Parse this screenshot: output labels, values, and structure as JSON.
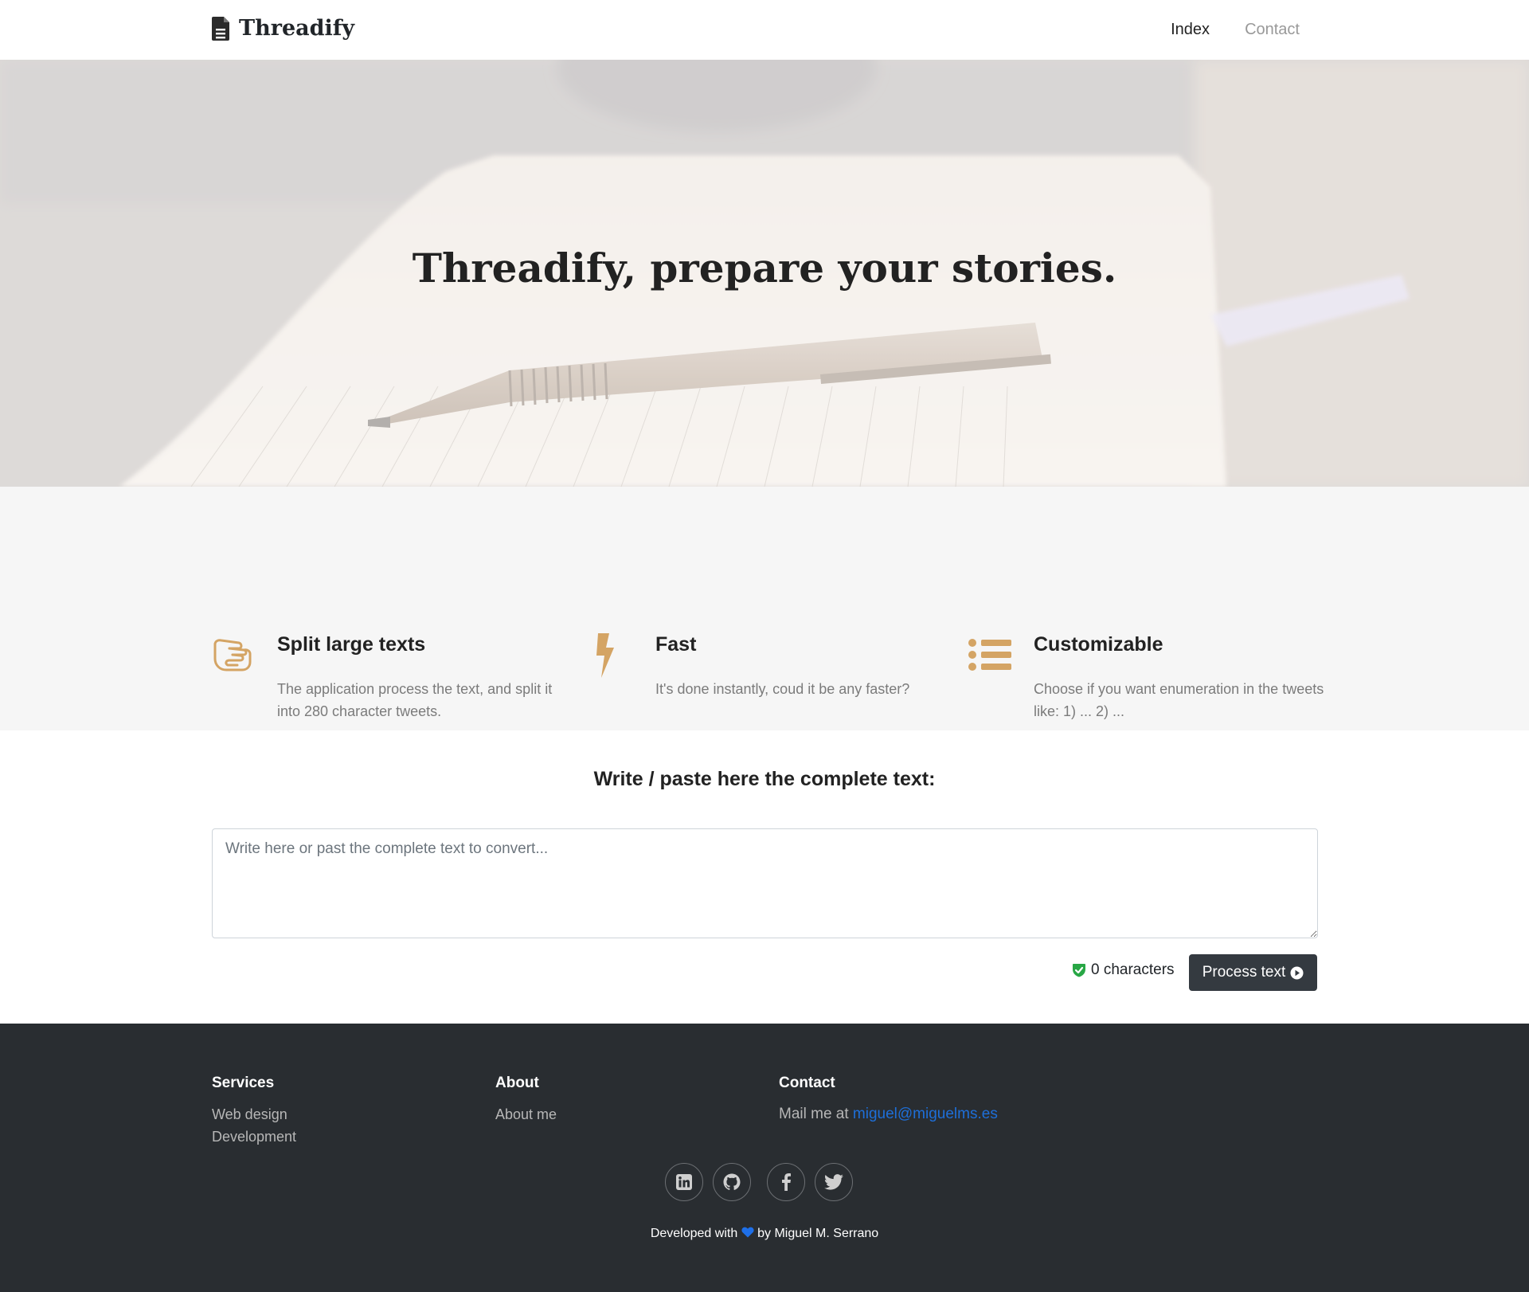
{
  "navbar": {
    "brand": "Threadify",
    "brand_icon": "file-icon",
    "links": [
      "Index",
      "Contact"
    ]
  },
  "hero": {
    "title_bold": "Threadify",
    "title_rest": ", prepare your stories."
  },
  "features": [
    {
      "icon": "hand-peace-icon",
      "title": "Split large texts",
      "text": "The application process the text, and split it into 280 character tweets."
    },
    {
      "icon": "bolt-icon",
      "title": "Fast",
      "text": "It's done instantly, coud it be any faster?"
    },
    {
      "icon": "list-icon",
      "title": "Customizable",
      "text": "Choose if you want enumeration in the tweets like: 1) ... 2) ..."
    }
  ],
  "input": {
    "title": "Write / paste here the complete text:",
    "placeholder": "Write here or past the complete text to convert...",
    "value": "",
    "char_count": "0 characters",
    "process_label": "Process text"
  },
  "footer": {
    "services": {
      "heading": "Services",
      "items": [
        "Web design",
        "Development"
      ]
    },
    "about": {
      "heading": "About",
      "items": [
        "About me"
      ]
    },
    "contact": {
      "heading": "Contact",
      "mail_prefix": "Mail me at ",
      "email": "miguel@miguelms.es"
    },
    "socials": [
      "linkedin-icon",
      "github-icon",
      "facebook-icon",
      "twitter-icon"
    ],
    "credit_prefix": "Developed with",
    "credit_suffix": "by Miguel M. Serrano"
  },
  "colors": {
    "accent": "#d4a464",
    "dark": "#343a40",
    "footer_bg": "#292d31",
    "features_bg": "#f6f6f6",
    "link_blue": "#1e6fd9",
    "check_green": "#28a745"
  }
}
